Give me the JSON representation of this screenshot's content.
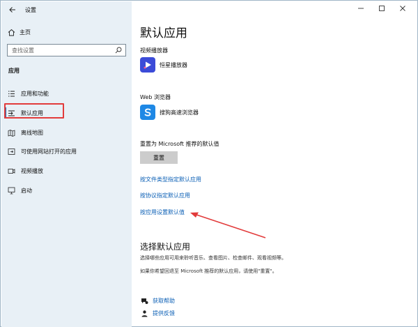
{
  "window": {
    "title": "设置",
    "back_icon": "arrow-left-icon",
    "minimize_icon": "minimize-icon",
    "maximize_icon": "maximize-icon",
    "close_icon": "close-icon"
  },
  "sidebar": {
    "home_label": "主页",
    "search_placeholder": "查找设置",
    "section_label": "应用",
    "items": [
      {
        "label": "应用和功能",
        "icon": "list-icon"
      },
      {
        "label": "默认应用",
        "icon": "default-apps-icon",
        "selected": true
      },
      {
        "label": "离线地图",
        "icon": "map-icon"
      },
      {
        "label": "可使用网站打开的应用",
        "icon": "open-in-app-icon"
      },
      {
        "label": "视频播放",
        "icon": "video-icon"
      },
      {
        "label": "启动",
        "icon": "startup-icon"
      }
    ]
  },
  "main": {
    "title": "默认应用",
    "video_player": {
      "heading": "视频播放器",
      "app_name": "恒星播放器"
    },
    "web_browser": {
      "heading": "Web 浏览器",
      "app_name": "搜狗高速浏览器"
    },
    "reset": {
      "heading": "重置为 Microsoft 推荐的默认值",
      "button_label": "重置"
    },
    "links": [
      "按文件类型指定默认应用",
      "按协议指定默认应用",
      "按应用设置默认值"
    ],
    "choose": {
      "title": "选择默认应用",
      "desc1": "选择哪些应用可用来聆听音乐、查看图片、检查邮件、观看视频等。",
      "desc2": "如果你希望回退至 Microsoft 推荐的默认应用，请使用\"重置\"。"
    },
    "help": [
      {
        "label": "获取帮助",
        "icon": "help-chat-icon"
      },
      {
        "label": "提供反馈",
        "icon": "feedback-icon"
      }
    ]
  },
  "colors": {
    "sidebar_bg": "#e8f0f6",
    "accent": "#1a6fb5",
    "link": "#0b5fb5",
    "annotation_red": "#e23b3b"
  }
}
